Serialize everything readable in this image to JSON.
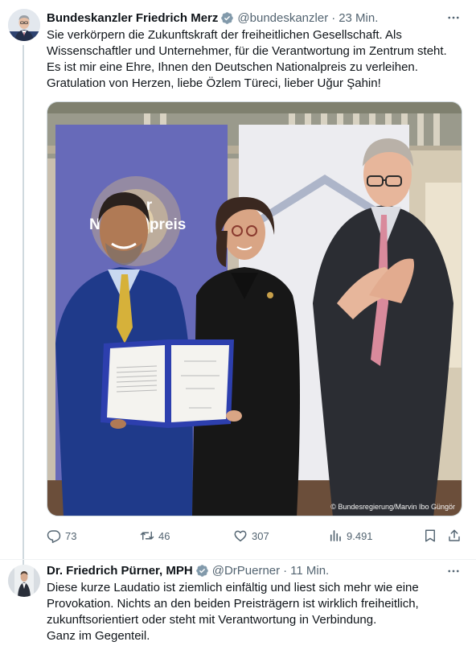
{
  "tweet1": {
    "author_name": "Bundeskanzler Friedrich Merz",
    "handle": "@bundeskanzler",
    "time": "23 Min.",
    "text_lines": [
      "Sie verkörpern die Zukunftskraft der freiheitlichen Gesellschaft. Als",
      "Wissenschaftler und Unternehmer, für die Verantwortung im Zentrum steht.",
      "Es ist mir eine Ehre, Ihnen den Deutschen Nationalpreis zu verleihen.",
      "Gratulation von Herzen, liebe Özlem Türeci, lieber Uğur Şahin!"
    ],
    "image": {
      "banner_text_line1": "cher",
      "banner_text_line2": "Nationalpreis",
      "credit": "© Bundesregierung/Marvin Ibo Güngör"
    },
    "stats": {
      "replies": "73",
      "retweets": "46",
      "likes": "307",
      "views": "9.491"
    }
  },
  "tweet2": {
    "author_name": "Dr. Friedrich Pürner, MPH",
    "handle": "@DrPuerner",
    "time": "11 Min.",
    "text_lines": [
      "Diese kurze Laudatio ist ziemlich einfältig und liest sich mehr wie eine",
      "Provokation. Nichts an den beiden Preisträgern ist wirklich freiheitlich,",
      "zukunftsorientiert oder steht mit Verantwortung in Verbindung.",
      "Ganz im Gegenteil."
    ]
  },
  "icons": {
    "verified": "verified-badge-icon",
    "more": "more-icon",
    "reply": "reply-icon",
    "retweet": "retweet-icon",
    "like": "heart-icon",
    "views": "views-icon",
    "bookmark": "bookmark-icon",
    "share": "share-icon"
  },
  "colors": {
    "text": "#0f1419",
    "secondary": "#536471",
    "verified_grey": "#829aab",
    "thread_line": "#cfd9de"
  }
}
